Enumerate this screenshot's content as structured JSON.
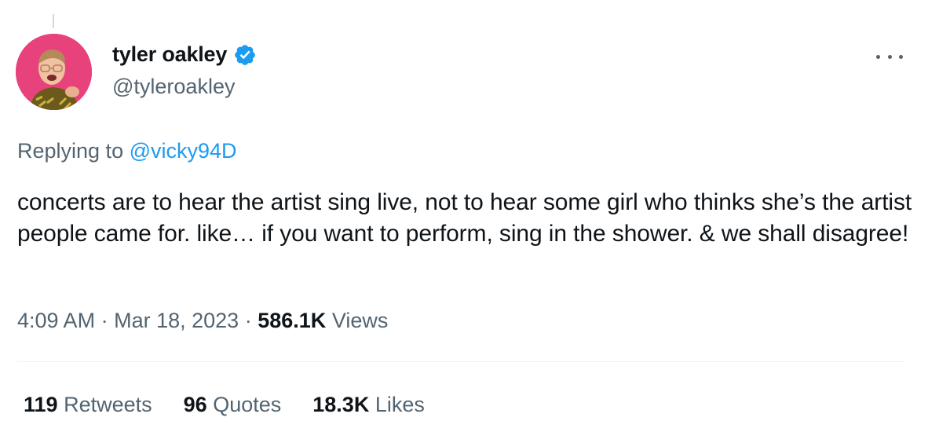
{
  "tweet": {
    "author": {
      "display_name": "tyler oakley",
      "handle": "@tyleroakley",
      "verified": true,
      "avatar_icon": "profile-photo"
    },
    "replying_prefix": "Replying to",
    "replying_to": "@vicky94D",
    "text": "concerts are to hear the artist sing live, not to hear some girl who thinks she’s the artist people came for. like… if you want to perform, sing in the shower. & we shall disagree!",
    "time": "4:09 AM",
    "separator": "·",
    "date": "Mar 18, 2023",
    "views_count": "586.1K",
    "views_label": "Views",
    "stats": {
      "retweets_count": "119",
      "retweets_label": "Retweets",
      "quotes_count": "96",
      "quotes_label": "Quotes",
      "likes_count": "18.3K",
      "likes_label": "Likes"
    }
  },
  "colors": {
    "link": "#1d9bf0",
    "secondary_text": "#536471",
    "primary_text": "#0f1419",
    "verified_badge": "#1d9bf0"
  }
}
